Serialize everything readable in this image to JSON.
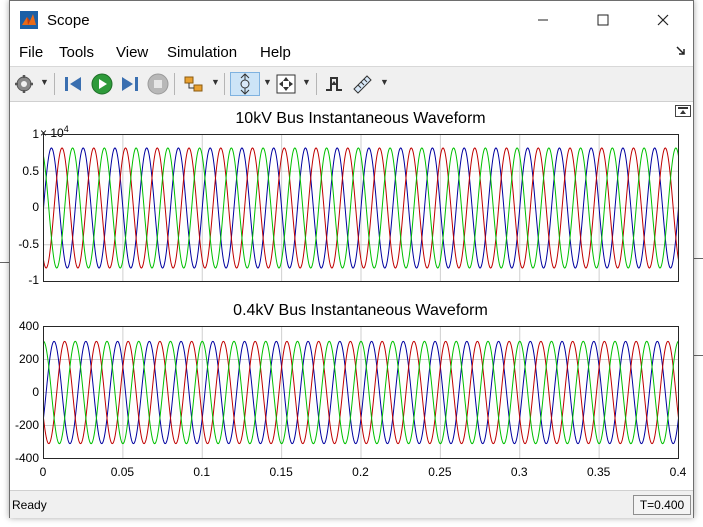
{
  "window": {
    "title": "Scope",
    "controls": [
      "minimize",
      "maximize",
      "close"
    ]
  },
  "menu": [
    "File",
    "Tools",
    "View",
    "Simulation",
    "Help"
  ],
  "toolbar": {
    "buttons": [
      "settings-icon",
      "step-back-icon",
      "run-icon",
      "step-forward-icon",
      "stop-icon",
      "highlight-block-icon",
      "zoom-icon",
      "autoscale-icon",
      "triggers-icon",
      "cursor-measurements-icon"
    ]
  },
  "plots": [
    {
      "title": "10kV Bus Instantaneous Waveform",
      "exponent_base": "× 10",
      "exponent_power": "4",
      "yticks": [
        "1",
        "0.5",
        "0",
        "-0.5",
        "-1"
      ]
    },
    {
      "title": "0.4kV Bus Instantaneous Waveform",
      "yticks": [
        "400",
        "200",
        "0",
        "-200",
        "-400"
      ],
      "xticks": [
        "0",
        "0.05",
        "0.1",
        "0.15",
        "0.2",
        "0.25",
        "0.3",
        "0.35",
        "0.4"
      ]
    }
  ],
  "chart_data": [
    {
      "type": "line",
      "title": "10kV Bus Instantaneous Waveform",
      "xlim": [
        0,
        0.4
      ],
      "ylim": [
        -10000,
        10000
      ],
      "y_exponent": 4,
      "frequency_hz": 50,
      "series": [
        {
          "color": "#0000a0",
          "amplitude": 8165,
          "phase_deg": 0
        },
        {
          "color": "#c00000",
          "amplitude": 8165,
          "phase_deg": -120
        },
        {
          "color": "#00c000",
          "amplitude": 8165,
          "phase_deg": 120
        }
      ]
    },
    {
      "type": "line",
      "title": "0.4kV Bus Instantaneous Waveform",
      "xlim": [
        0,
        0.4
      ],
      "ylim": [
        -400,
        400
      ],
      "frequency_hz": 50,
      "series": [
        {
          "color": "#0000a0",
          "amplitude": 310,
          "phase_deg": -30
        },
        {
          "color": "#c00000",
          "amplitude": 310,
          "phase_deg": -150
        },
        {
          "color": "#00c000",
          "amplitude": 310,
          "phase_deg": 90
        }
      ]
    }
  ],
  "status": {
    "text": "Ready",
    "time": "T=0.400"
  }
}
